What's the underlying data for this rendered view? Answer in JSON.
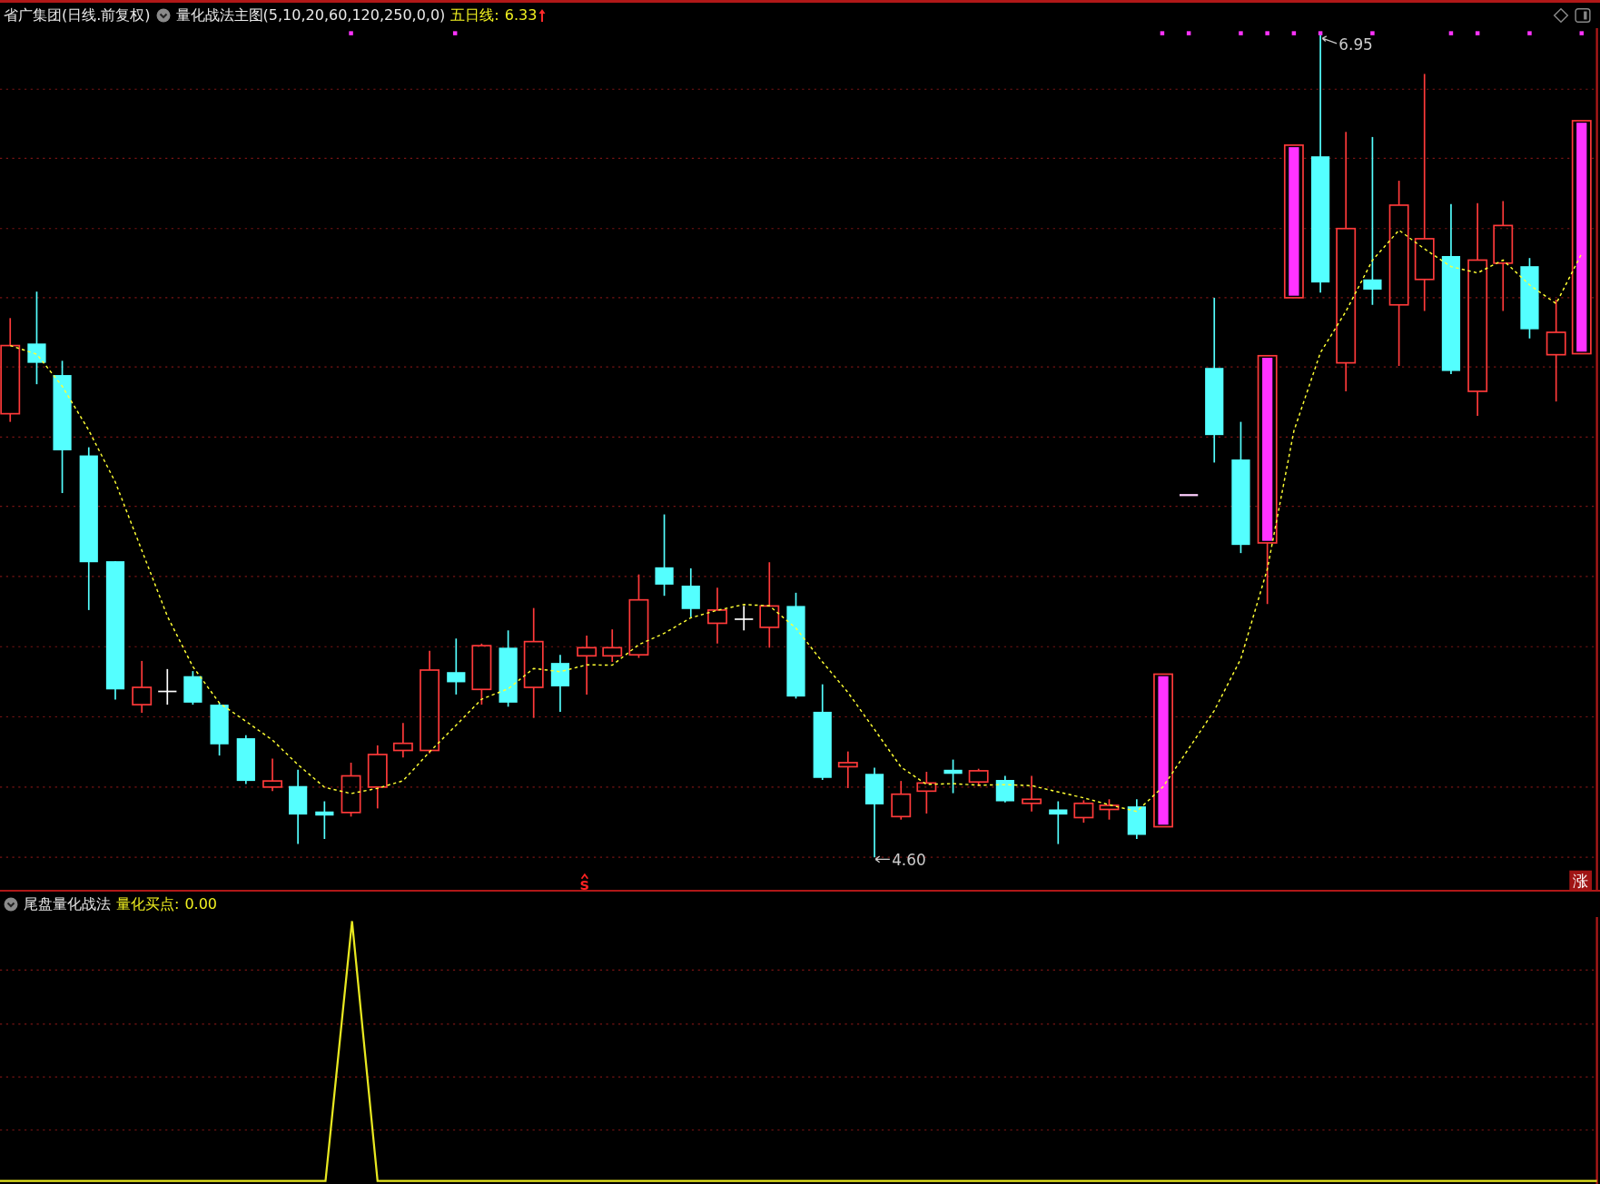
{
  "main_panel": {
    "stock_title": "省广集团(日线.前复权)",
    "indicator_name": "量化战法主图(5,10,20,60,120,250,0,0)",
    "ma_label": "五日线:",
    "ma_value": "6.33",
    "high_label": "6.95",
    "low_label": "4.60",
    "signal_marker": "S",
    "rise_badge": "涨"
  },
  "sub_panel": {
    "indicator_name": "尾盘量化战法",
    "value_label": "量化买点:",
    "value": "0.00"
  }
}
